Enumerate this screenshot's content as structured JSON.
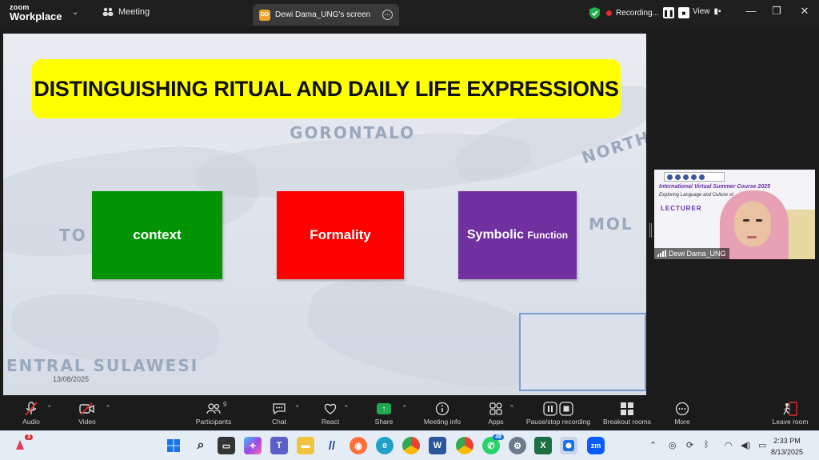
{
  "titlebar": {
    "logo_line1": "zoom",
    "logo_line2": "Workplace",
    "meeting_tab": "Meeting",
    "screen_tab": {
      "initials": "DD",
      "label": "Dewi Dama_UNG's screen"
    },
    "recording_label": "Recording...",
    "view_label": "View"
  },
  "slide": {
    "title": "DISTINGUISHING RITUAL AND DAILY LIFE EXPRESSIONS",
    "map_labels": {
      "gorontalo": "GORONTALO",
      "north": "NORTH",
      "to": "TO",
      "mol": "MOL",
      "central": "ENTRAL SULAWESI"
    },
    "boxes": [
      {
        "text": "context",
        "color": "#029402"
      },
      {
        "text_main": "Formality",
        "color": "#ff0000"
      },
      {
        "text_main": "Symbolic",
        "text_small": "Function",
        "color": "#7030a0"
      }
    ],
    "date": "13/08/2025"
  },
  "video": {
    "banner_title": "International Virtual Summer Course 2025",
    "banner_sub": "Exploring Language and Culture of",
    "banner_role": "LECTURER",
    "participant_name": "Dewi Dama_UNG"
  },
  "toolbar": {
    "audio": "Audio",
    "video": "Video",
    "participants": "Participants",
    "participants_count": "9",
    "chat": "Chat",
    "react": "React",
    "share": "Share",
    "meeting_info": "Meeting info",
    "apps": "Apps",
    "pause_stop": "Pause/stop recording",
    "breakout": "Breakout rooms",
    "more": "More",
    "leave": "Leave room"
  },
  "taskbar": {
    "notif_badge": "3",
    "whatsapp_badge": "48",
    "zoom_label": "zm",
    "time": "2:33 PM",
    "date": "8/13/2025"
  },
  "colors": {
    "title_yellow": "#ffff00",
    "green": "#029402",
    "red": "#ff0000",
    "purple": "#7030a0",
    "recording_red": "#e02c2c"
  }
}
